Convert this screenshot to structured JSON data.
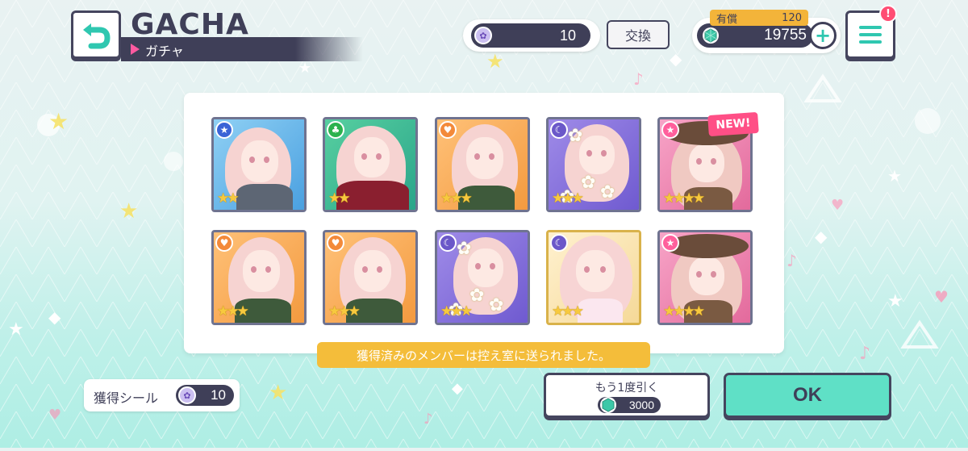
{
  "header": {
    "title": "GACHA",
    "subtitle": "ガチャ",
    "seal_count": "10",
    "exchange_label": "交換",
    "paid_label": "有償",
    "paid_value": "120",
    "gem_total": "19755"
  },
  "cards": [
    {
      "attribute": "star-icon",
      "rarity": 2
    },
    {
      "attribute": "leaf-icon",
      "rarity": 2
    },
    {
      "attribute": "heart-icon",
      "rarity": 3
    },
    {
      "attribute": "moon-icon",
      "rarity": 3
    },
    {
      "attribute": "star-icon",
      "rarity": 4,
      "new": true
    },
    {
      "attribute": "heart-icon",
      "rarity": 3
    },
    {
      "attribute": "heart-icon",
      "rarity": 3
    },
    {
      "attribute": "moon-icon",
      "rarity": 3
    },
    {
      "attribute": "moon-icon",
      "rarity": 3
    },
    {
      "attribute": "star-icon",
      "rarity": 4
    }
  ],
  "new_badge": "NEW!",
  "notice": "獲得済みのメンバーは控え室に送られました。",
  "footer": {
    "seal_label": "獲得シール",
    "seal_value": "10",
    "redraw_label": "もう1度引く",
    "redraw_cost": "3000",
    "ok_label": "OK"
  },
  "colors": {
    "accent_dark": "#3f3f58",
    "ok_button": "#5fe0c6",
    "notice": "#f4bd3a",
    "new_badge": "#ff4f86"
  }
}
